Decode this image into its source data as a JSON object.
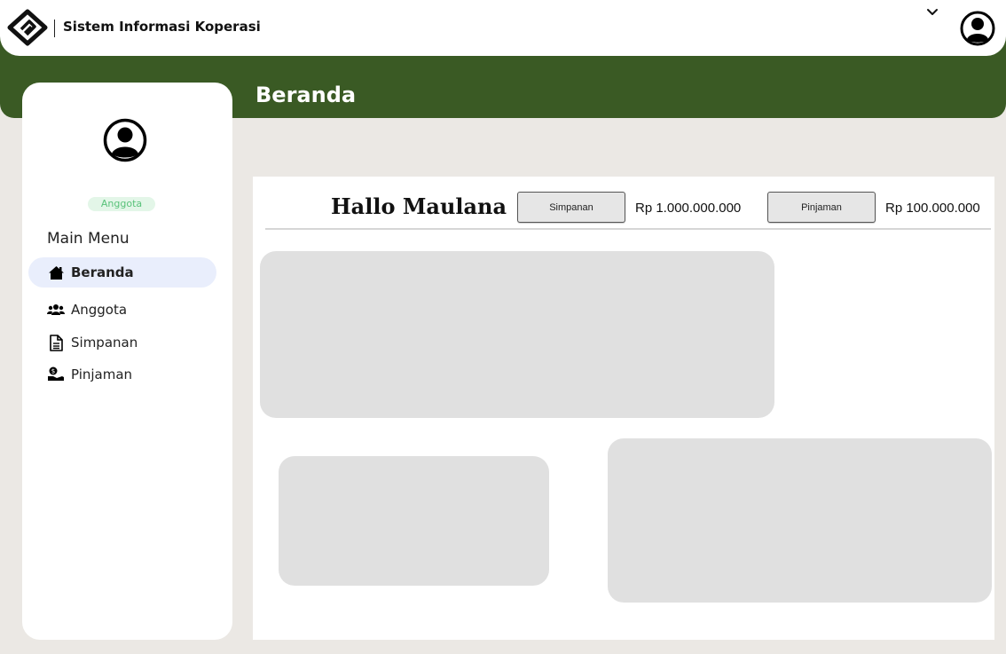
{
  "header": {
    "app_title": "Sistem Informasi Koperasi"
  },
  "page": {
    "title": "Beranda"
  },
  "sidebar": {
    "role_badge": "Anggota",
    "menu_heading": "Main Menu",
    "items": [
      {
        "label": "Beranda",
        "icon": "home-icon",
        "active": true
      },
      {
        "label": "Anggota",
        "icon": "users-icon",
        "active": false
      },
      {
        "label": "Simpanan",
        "icon": "document-icon",
        "active": false
      },
      {
        "label": "Pinjaman",
        "icon": "hand-coin-icon",
        "active": false
      }
    ]
  },
  "dashboard": {
    "greeting": "Hallo Maulana",
    "simpanan_label": "Simpanan",
    "simpanan_value": "Rp 1.000.000.000",
    "pinjaman_label": "Pinjaman",
    "pinjaman_value": "Rp 100.000.000"
  },
  "colors": {
    "brand_green": "#3a5a24",
    "background": "#ebe8e4",
    "active_menu": "#e9eefc",
    "badge_text": "#59c27a",
    "placeholder": "#e0e0e0"
  }
}
